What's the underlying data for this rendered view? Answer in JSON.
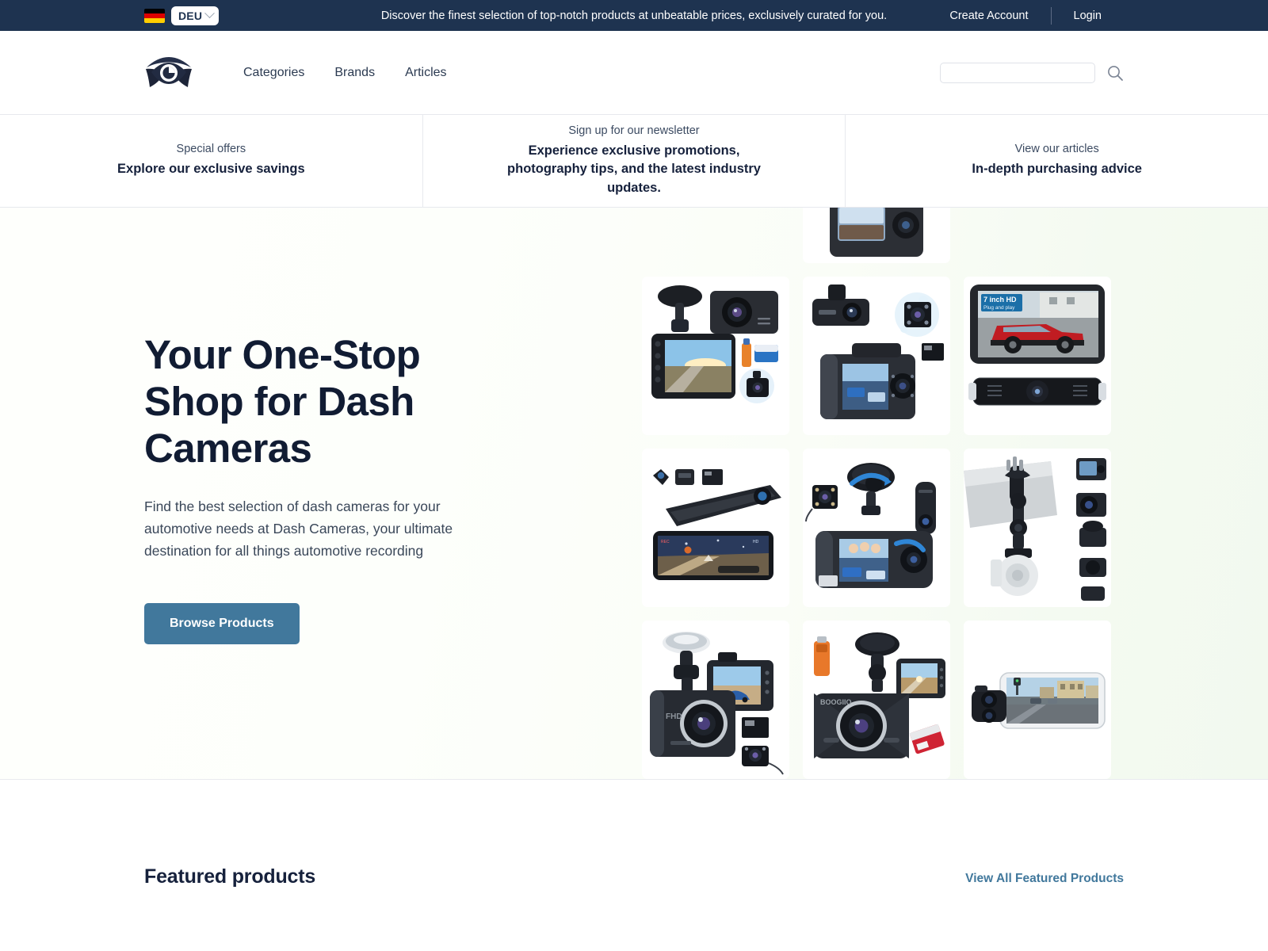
{
  "topbar": {
    "flag_icon": "german-flag-icon",
    "language": "DEU",
    "chevron_icon": "chevron-down-icon",
    "message": "Discover the finest selection of top-notch products at unbeatable prices, exclusively curated for you.",
    "create_account": "Create Account",
    "login": "Login"
  },
  "header": {
    "logo_icon": "winged-eye-logo-icon",
    "nav": [
      {
        "label": "Categories"
      },
      {
        "label": "Brands"
      },
      {
        "label": "Articles"
      }
    ],
    "search": {
      "value": "",
      "placeholder": "",
      "icon": "search-icon"
    }
  },
  "promos": [
    {
      "sub": "Special offers",
      "title": "Explore our exclusive savings"
    },
    {
      "sub": "Sign up for our newsletter",
      "title": "Experience exclusive promotions, photography tips, and the latest industry updates."
    },
    {
      "sub": "View our articles",
      "title": "In-depth purchasing advice"
    }
  ],
  "hero": {
    "heading": "Your One-Stop Shop for Dash Cameras",
    "paragraph": "Find the best selection of dash cameras for your automotive needs at Dash Cameras, your ultimate destination for all things automotive recording",
    "cta_label": "Browse Products",
    "cta_color": "#41789c",
    "tiles": [
      {
        "name": "dashcam-with-rear-camera-and-sd-card",
        "badge": ""
      },
      {
        "name": "dual-lens-dashcam-waterproof-rear-cam",
        "badge": ""
      },
      {
        "name": "seven-inch-hd-monitor-with-truck",
        "badge": "7 inch HD",
        "badge_sub": "Plug and play"
      },
      {
        "name": "mirror-dashcam-with-accessories",
        "badge": ""
      },
      {
        "name": "three-channel-dashcam-suction-mount",
        "badge": ""
      },
      {
        "name": "dashcam-mounting-bracket-kit",
        "badge": ""
      },
      {
        "name": "fhd-dashcam-suction-mount-rear-cam",
        "badge": ""
      },
      {
        "name": "boogiio-dashcam-with-usb-reader",
        "badge": ""
      },
      {
        "name": "dashcam-with-smartphone-app-view",
        "badge": ""
      },
      {
        "name": "dashcam-suction-mount-bottom",
        "badge": ""
      }
    ]
  },
  "featured": {
    "title": "Featured products",
    "view_all": "View All Featured Products"
  },
  "colors": {
    "navy": "#1e3350",
    "accent": "#41789c",
    "text": "#16213c"
  }
}
